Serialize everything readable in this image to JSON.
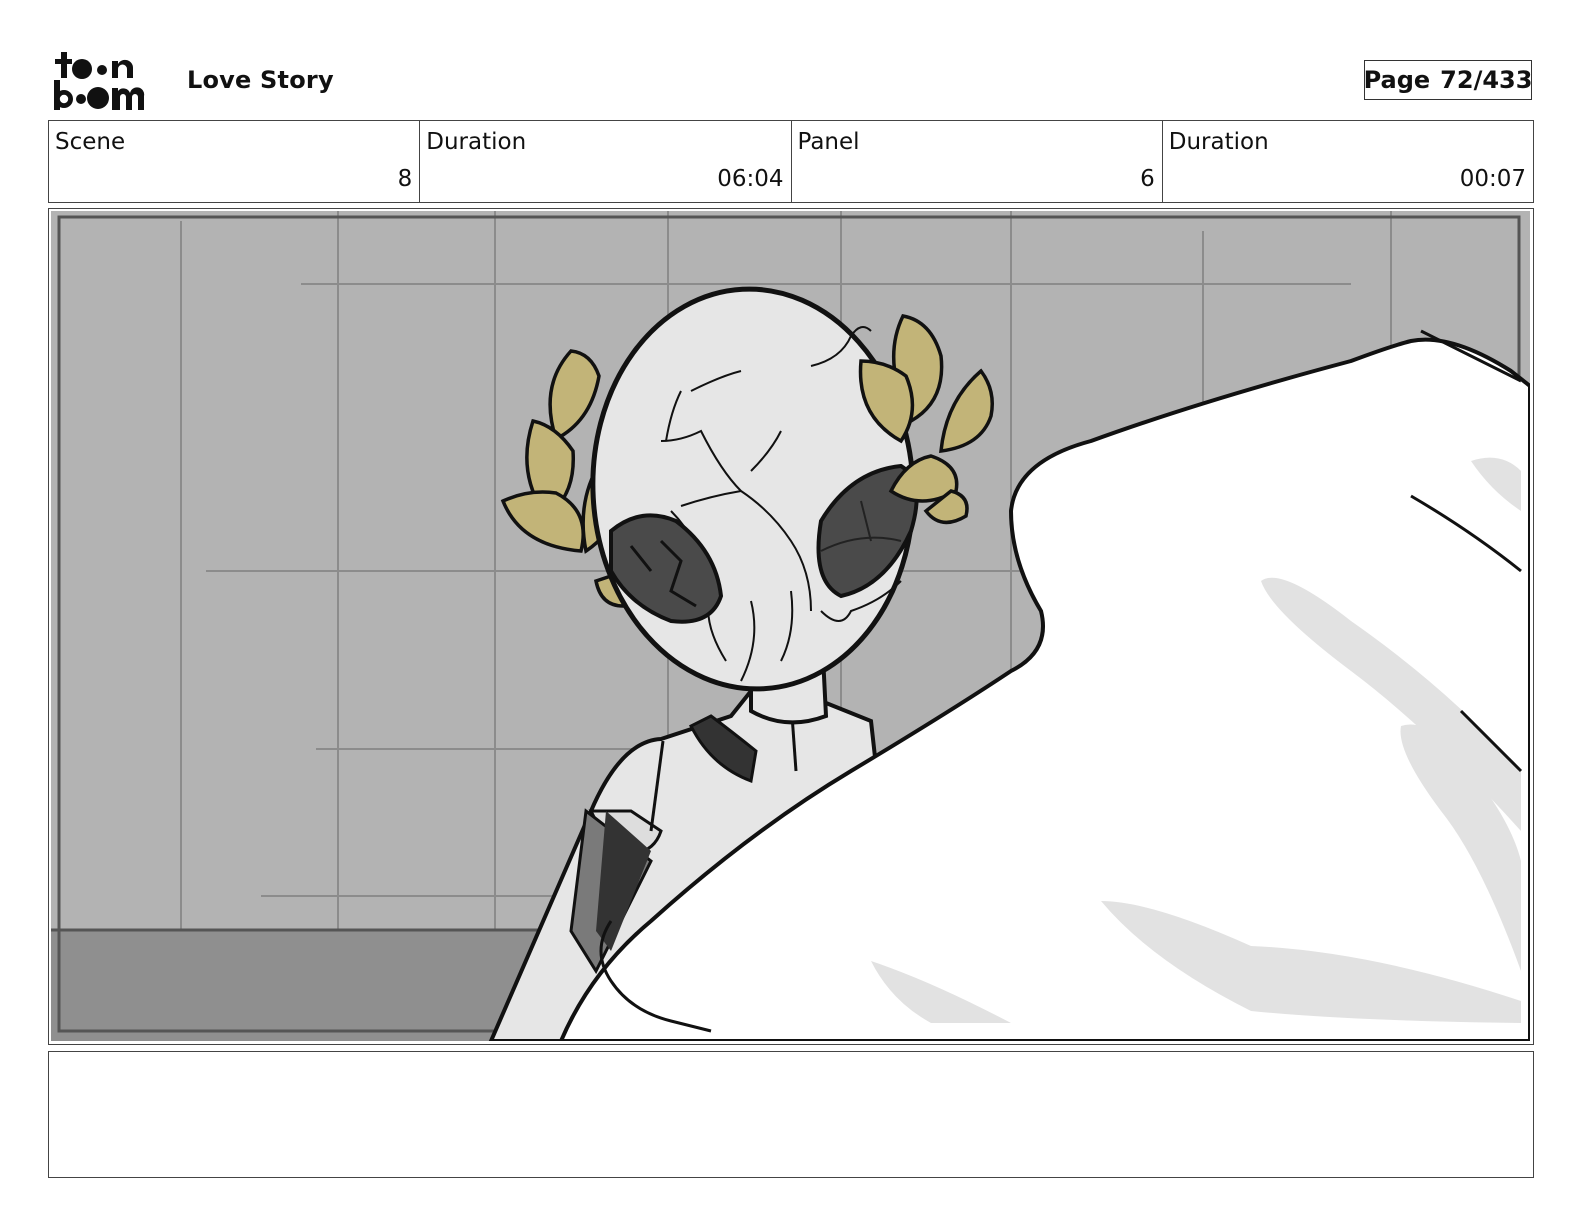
{
  "header": {
    "logo_text": "toon boom",
    "project_title": "Love Story",
    "page_label": "Page",
    "page_number": "72/433"
  },
  "info": {
    "scene_label": "Scene",
    "scene_value": "8",
    "scene_duration_label": "Duration",
    "scene_duration_value": "06:04",
    "panel_label": "Panel",
    "panel_value": "6",
    "panel_duration_label": "Duration",
    "panel_duration_value": "00:07"
  },
  "notes": {
    "text": ""
  },
  "colors": {
    "wall": "#b3b3b3",
    "floor": "#8f8f8f",
    "head": "#e6e6e6",
    "laurel": "#c2b478",
    "eye": "#4a4a4a",
    "wing": "#ffffff",
    "wing_shadow": "#e2e2e2"
  }
}
